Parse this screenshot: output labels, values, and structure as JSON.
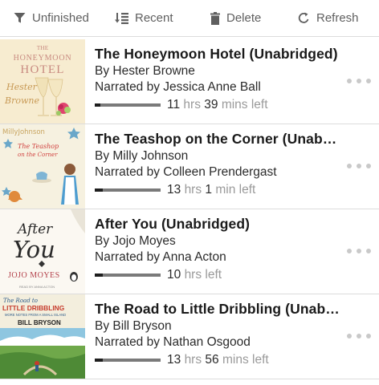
{
  "toolbar": {
    "unfinished_label": "Unfinished",
    "recent_label": "Recent",
    "delete_label": "Delete",
    "refresh_label": "Refresh"
  },
  "books": [
    {
      "title": "The Honeymoon Hotel (Unabridged)",
      "author": "By Hester Browne",
      "narrator": "Narrated by Jessica Anne Ball",
      "hours": "11",
      "hours_unit": "hrs",
      "minutes": "39",
      "minutes_unit": "mins left",
      "progress": 0.08,
      "cover": {
        "title_line1": "THE",
        "title_line2": "HONEYMOON",
        "title_line3": "HOTEL",
        "author_line1": "Hester",
        "author_line2": "Browne"
      }
    },
    {
      "title": "The Teashop on the Corner (Unabridged)",
      "author": "By Milly Johnson",
      "narrator": "Narrated by Colleen Prendergast",
      "hours": "13",
      "hours_unit": "hrs",
      "minutes": "1",
      "minutes_unit": "min left",
      "progress": 0.12,
      "cover": {
        "author_line": "MillyJohnson",
        "title_line1": "The Teashop",
        "title_line2": "on the Corner"
      }
    },
    {
      "title": "After You (Unabridged)",
      "author": "By Jojo Moyes",
      "narrator": "Narrated by Anna Acton",
      "hours": "10",
      "hours_unit": "hrs",
      "minutes": "",
      "minutes_unit": "left",
      "progress": 0.12,
      "cover": {
        "title_line1": "After",
        "title_line2": "You",
        "author_line": "JOJO MOYES",
        "narrator_line": "READ BY ANNA ACTON"
      }
    },
    {
      "title": "The Road to Little Dribbling (Unabridged)",
      "author": "By Bill Bryson",
      "narrator": "Narrated by Nathan Osgood",
      "hours": "13",
      "hours_unit": "hrs",
      "minutes": "56",
      "minutes_unit": "mins left",
      "progress": 0.12,
      "cover": {
        "title_line1": "The Road to",
        "title_line2": "LITTLE DRIBBLING",
        "subtitle": "MORE NOTES FROM A SMALL ISLAND",
        "author_line": "BILL BRYSON"
      }
    }
  ],
  "colors": {
    "toolbar_text": "#5f5f5f",
    "divider": "#dcdcdc",
    "progress_track": "#7a7a7a",
    "progress_fill": "#1e1e1e",
    "more_dots": "#c9c9c9"
  },
  "icons": {
    "filter": "filter-icon",
    "sort": "sort-icon",
    "delete": "trash-icon",
    "refresh": "refresh-icon",
    "more": "more-dots-icon"
  }
}
